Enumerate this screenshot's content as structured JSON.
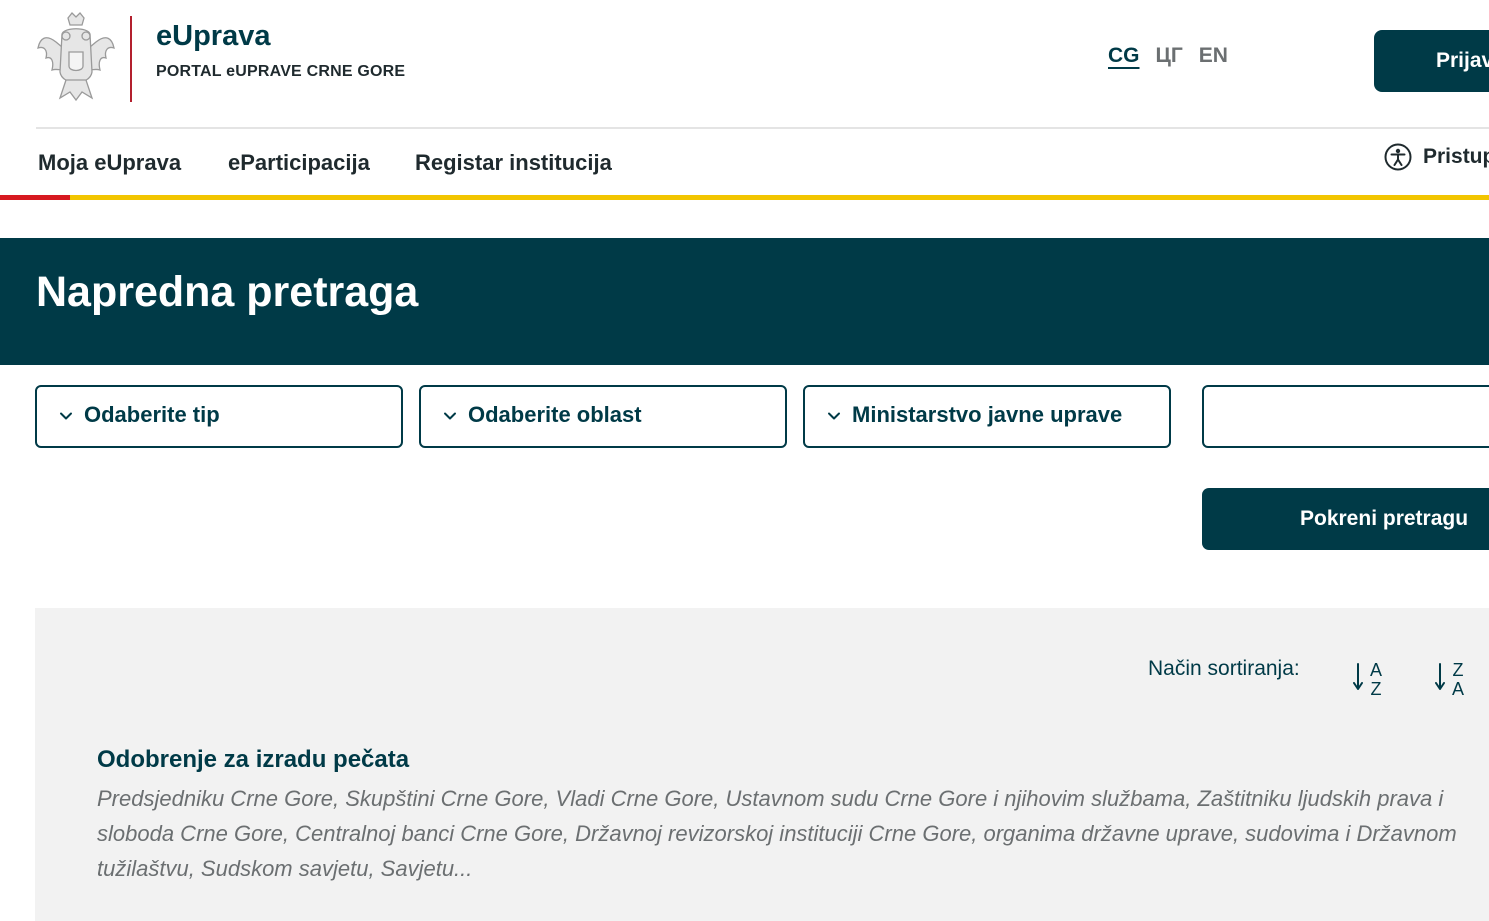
{
  "header": {
    "brand_title": "eUprava",
    "brand_subtitle": "PORTAL eUPRAVE CRNE GORE",
    "languages": [
      {
        "label": "CG",
        "active": true
      },
      {
        "label": "ЦГ",
        "active": false
      },
      {
        "label": "EN",
        "active": false
      }
    ],
    "login_label": "Prijava",
    "coat_of_arms_icon": "montenegro-coat-of-arms-icon"
  },
  "nav": {
    "items": [
      {
        "label": "Moja eUprava",
        "active": true
      },
      {
        "label": "eParticipacija",
        "active": false
      },
      {
        "label": "Registar institucija",
        "active": false
      }
    ],
    "accessibility_label": "Pristupačnost",
    "accessibility_icon": "accessibility-icon"
  },
  "banner": {
    "title": "Napredna pretraga"
  },
  "filters": {
    "type_select": "Odaberite tip",
    "area_select": "Odaberite oblast",
    "institution_select": "Ministarstvo javne uprave",
    "search_value": "",
    "search_button": "Pokreni pretragu",
    "chevron_icon": "chevron-down-icon"
  },
  "results": {
    "sort_label": "Način sortiranja:",
    "sort_options": [
      {
        "name": "sort-a-z-icon",
        "top": "A",
        "bottom": "Z"
      },
      {
        "name": "sort-z-a-icon",
        "top": "Z",
        "bottom": "A"
      }
    ],
    "items": [
      {
        "title": "Odobrenje za izradu pečata",
        "description": "Predsjedniku Crne Gore, Skupštini Crne Gore, Vladi Crne Gore, Ustavnom sudu Crne Gore i njihovim službama, Zaštitniku ljudskih prava i sloboda Crne Gore, Centralnoj banci Crne Gore, Državnoj revizorskoj instituciji Crne Gore, organima državne uprave, sudovima i Državnom tužilaštvu, Sudskom savjetu, Savjetu..."
      }
    ]
  },
  "colors": {
    "primary": "#003a47",
    "accent_yellow": "#f2c500",
    "accent_red": "#d71920",
    "results_bg": "#f2f2f2"
  }
}
